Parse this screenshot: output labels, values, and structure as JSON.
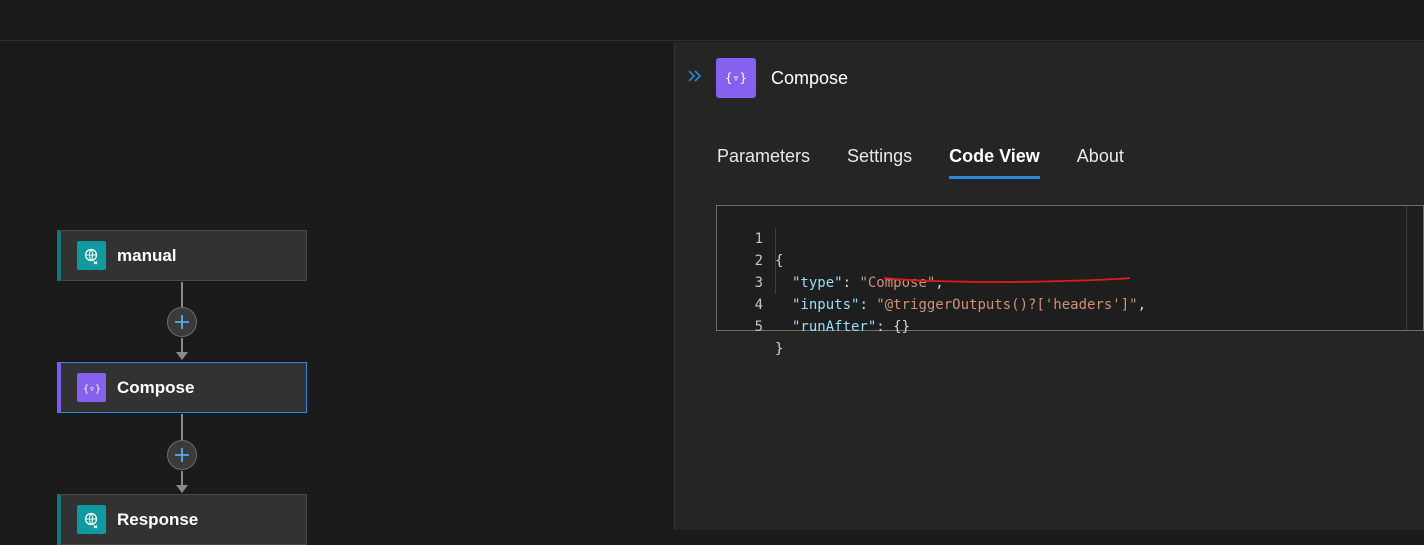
{
  "flow": {
    "nodes": [
      {
        "label": "manual",
        "icon": "http-request-icon"
      },
      {
        "label": "Compose",
        "icon": "compose-icon"
      },
      {
        "label": "Response",
        "icon": "http-request-icon"
      }
    ]
  },
  "panel": {
    "title": "Compose",
    "icon": "compose-icon",
    "tabs": [
      {
        "label": "Parameters",
        "active": false
      },
      {
        "label": "Settings",
        "active": false
      },
      {
        "label": "Code View",
        "active": true
      },
      {
        "label": "About",
        "active": false
      }
    ],
    "code": {
      "line_numbers": [
        "1",
        "2",
        "3",
        "4",
        "5"
      ],
      "open_brace": "{",
      "type_key": "\"type\"",
      "type_value": "\"Compose\"",
      "inputs_key": "\"inputs\"",
      "inputs_value": "\"@triggerOutputs()?['headers']\"",
      "runafter_key": "\"runAfter\"",
      "runafter_value": "{}",
      "close_brace": "}"
    }
  },
  "colors": {
    "accent": "#2b88d8",
    "compose_purple": "#8661f0",
    "http_teal": "#0f9aa0",
    "annotation_red": "#e01b1b"
  }
}
